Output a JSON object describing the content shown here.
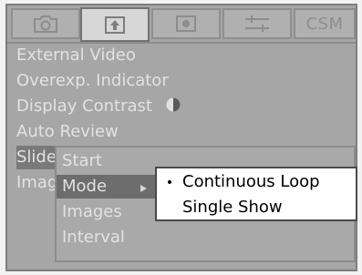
{
  "tabs": [
    {
      "name": "camera-icon"
    },
    {
      "name": "playback-icon",
      "active": true
    },
    {
      "name": "setup-icon"
    },
    {
      "name": "tools-icon"
    },
    {
      "label": "CSM"
    }
  ],
  "menu": {
    "items": [
      {
        "label": "External Video"
      },
      {
        "label": "Overexp. Indicator"
      },
      {
        "label": "Display Contrast"
      },
      {
        "label": "Auto Review"
      },
      {
        "label": "Slideshow"
      },
      {
        "label": "Image"
      }
    ]
  },
  "submenu": {
    "items": [
      {
        "label": "Start"
      },
      {
        "label": "Mode"
      },
      {
        "label": "Images"
      },
      {
        "label": "Interval"
      }
    ]
  },
  "popup": {
    "items": [
      {
        "label": "Continuous Loop",
        "selected": true
      },
      {
        "label": "Single Show"
      }
    ],
    "bullet": "•"
  },
  "colors": {
    "frame": "#a6a6a6",
    "highlight": "#6d6d6d",
    "text": "#e2e2e2",
    "popup_bg": "#ffffff"
  }
}
